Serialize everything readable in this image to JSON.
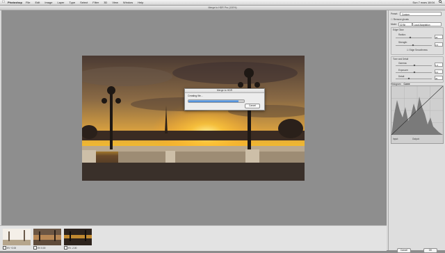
{
  "menubar": {
    "app_name": "Photoshop",
    "menus": [
      "File",
      "Edit",
      "Image",
      "Layer",
      "Type",
      "Select",
      "Filter",
      "3D",
      "View",
      "Window",
      "Help"
    ],
    "clock": "Sun 7 mars 18:04",
    "apple_icon": "apple-icon",
    "search_icon": "spotlight-search-icon"
  },
  "window": {
    "title": "Merge to HDR Pro (100%)"
  },
  "dialog": {
    "title": "Merge to HDR",
    "message": "Creating file...",
    "progress": 0.9,
    "cancel_label": "Cancel"
  },
  "filmstrip": {
    "thumbnails": [
      {
        "ev": "EV +2.00",
        "checked": true
      },
      {
        "ev": "EV 0.00",
        "checked": true
      },
      {
        "ev": "EV -2.00",
        "checked": true
      }
    ]
  },
  "panel": {
    "preset_label": "Preset:",
    "preset_value": "Custom",
    "remove_ghosts": "Remove ghosts",
    "mode_label": "Mode:",
    "mode_value": "32 Bit",
    "mode_method": "Local Adaptation",
    "edge_glow_title": "Edge Glow",
    "radius_label": "Radius:",
    "radius_value": "28",
    "strength_label": "Strength:",
    "strength_value": "0.5",
    "edge_smoothness": "Edge Smoothness",
    "tone_detail_title": "Tone and Detail",
    "gamma_label": "Gamma:",
    "gamma_value": "1.0",
    "exposure_label": "Exposure:",
    "exposure_value": "0.0",
    "detail_label": "Detail:",
    "detail_value": "30",
    "tabs": [
      "Histogram",
      "Curve"
    ],
    "input_label": "Input:",
    "output_label": "Output:",
    "cancel_label": "Cancel",
    "ok_label": "OK"
  }
}
